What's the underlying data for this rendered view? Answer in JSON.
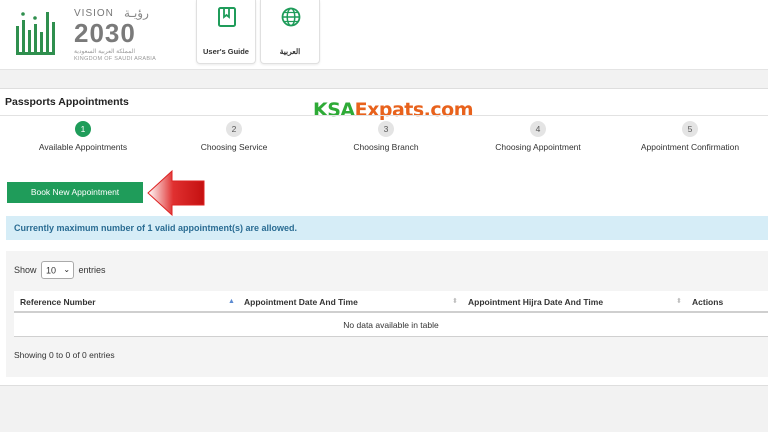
{
  "header": {
    "vision": {
      "top_en": "VISION",
      "top_ar": "رؤيـة",
      "year": "2030",
      "kingdom_ar": "المملكة العربية السعودية",
      "kingdom_en": "KINGDOM OF SAUDI ARABIA"
    },
    "buttons": [
      {
        "label": "User's Guide",
        "icon": "book-icon"
      },
      {
        "label": "العربية",
        "icon": "globe-icon"
      }
    ],
    "accent_color": "#1f9c5a"
  },
  "page": {
    "title": "Passports Appointments",
    "watermark": {
      "part1": "KSA",
      "part2": "Expats.com"
    }
  },
  "steps": [
    {
      "number": "1",
      "label": "Available Appointments",
      "active": true
    },
    {
      "number": "2",
      "label": "Choosing Service",
      "active": false
    },
    {
      "number": "3",
      "label": "Choosing Branch",
      "active": false
    },
    {
      "number": "4",
      "label": "Choosing Appointment",
      "active": false
    },
    {
      "number": "5",
      "label": "Appointment Confirmation",
      "active": false
    }
  ],
  "book_button": "Book New Appointment",
  "alert": "Currently maximum number of 1 valid appointment(s) are allowed.",
  "table": {
    "show_label": "Show",
    "entries_value": "10",
    "entries_label": "entries",
    "columns": [
      "Reference Number",
      "Appointment Date And Time",
      "Appointment Hijra Date And Time",
      "Actions"
    ],
    "empty_message": "No data available in table",
    "info": "Showing 0 to 0 of 0 entries"
  }
}
